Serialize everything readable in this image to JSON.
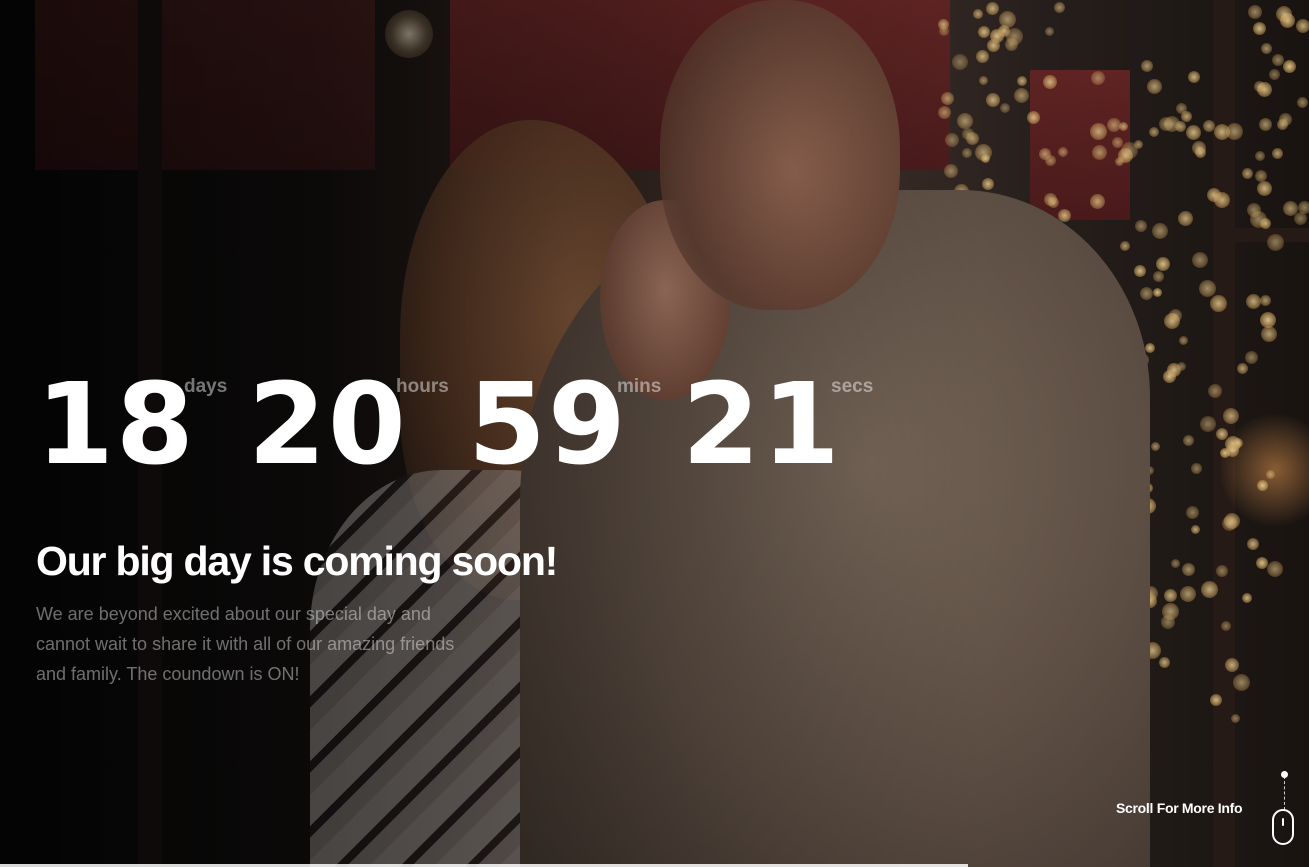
{
  "countdown": {
    "days": "18",
    "days_label": "days",
    "hours": "20",
    "hours_label": "hours",
    "mins": "59",
    "mins_label": "mins",
    "secs": "21",
    "secs_label": "secs"
  },
  "hero": {
    "headline": "Our big day is coming soon!",
    "intro": "We are beyond excited about our special day and cannot wait to share it with all of our amazing friends and family. The coundown is ON!",
    "background": "photo-couple-embracing-street-lights"
  },
  "scroll": {
    "label": "Scroll For More Info",
    "icon": "mouse-icon"
  },
  "colors": {
    "text_primary": "#ffffff",
    "text_muted": "rgba(255,255,255,0.45)"
  }
}
